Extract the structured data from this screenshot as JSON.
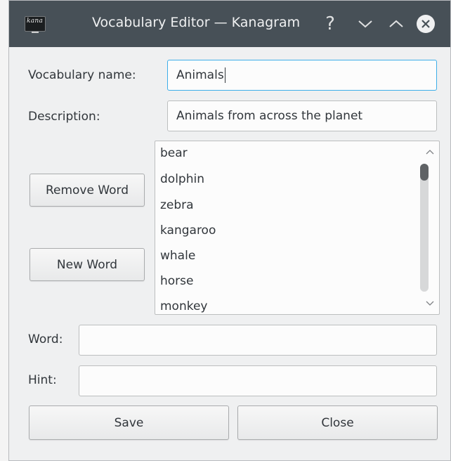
{
  "window": {
    "title": "Vocabulary Editor — Kanagram",
    "app_icon_text": "kana",
    "help_glyph": "?"
  },
  "form": {
    "vocabulary_name_label": "Vocabulary name:",
    "vocabulary_name_value": "Animals",
    "description_label": "Description:",
    "description_value": "Animals from across the planet",
    "word_label": "Word:",
    "word_value": "",
    "hint_label": "Hint:",
    "hint_value": ""
  },
  "buttons": {
    "remove_word": "Remove Word",
    "new_word": "New Word",
    "save": "Save",
    "close": "Close"
  },
  "word_list": {
    "items": [
      "bear",
      "dolphin",
      "zebra",
      "kangaroo",
      "whale",
      "horse",
      "monkey"
    ]
  },
  "icons": {
    "help": "help-icon",
    "minimize": "chevron-down-icon",
    "maximize": "chevron-up-icon",
    "close": "close-circle-icon"
  },
  "colors": {
    "titlebar": "#475057",
    "focus_border": "#3daee9",
    "window_bg": "#eff0f1"
  }
}
